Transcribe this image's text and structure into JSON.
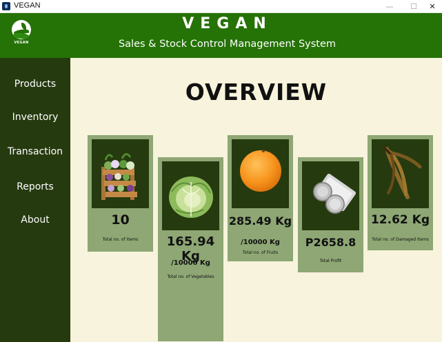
{
  "window": {
    "title": "VEGAN",
    "minimize_glyph": "—",
    "maximize_glyph": "☐",
    "close_glyph": "✕"
  },
  "header": {
    "logo_text": "VEGAN",
    "title": "VEGAN",
    "subtitle": "Sales & Stock Control Management System"
  },
  "sidebar": {
    "items": [
      {
        "label": "Products"
      },
      {
        "label": "Inventory"
      },
      {
        "label": "Transaction"
      },
      {
        "label": "Reports"
      },
      {
        "label": "About"
      }
    ]
  },
  "main": {
    "heading": "OVERVIEW",
    "cards": [
      {
        "value": "10",
        "caption": "Total no. of Items",
        "icon": "crate-icon"
      },
      {
        "value": "165.94 Kg",
        "sub": "/10000 Kg",
        "caption": "Total no. of Vegetables",
        "icon": "cabbage-icon"
      },
      {
        "value": "285.49 Kg",
        "sub": "/10000 Kg",
        "caption": "Total no. of Fruits",
        "icon": "orange-icon"
      },
      {
        "value": "P2658.8",
        "caption": "Total Profit",
        "icon": "coins-icon"
      },
      {
        "value": "12.62 Kg",
        "caption": "Total no. of Damaged Items",
        "icon": "rotten-banana-icon"
      }
    ]
  },
  "colors": {
    "header": "#257206",
    "sidebar": "#263a0f",
    "main_bg": "#f7f3dc",
    "card": "#8ea774",
    "card_image_bg": "#263a0f"
  }
}
